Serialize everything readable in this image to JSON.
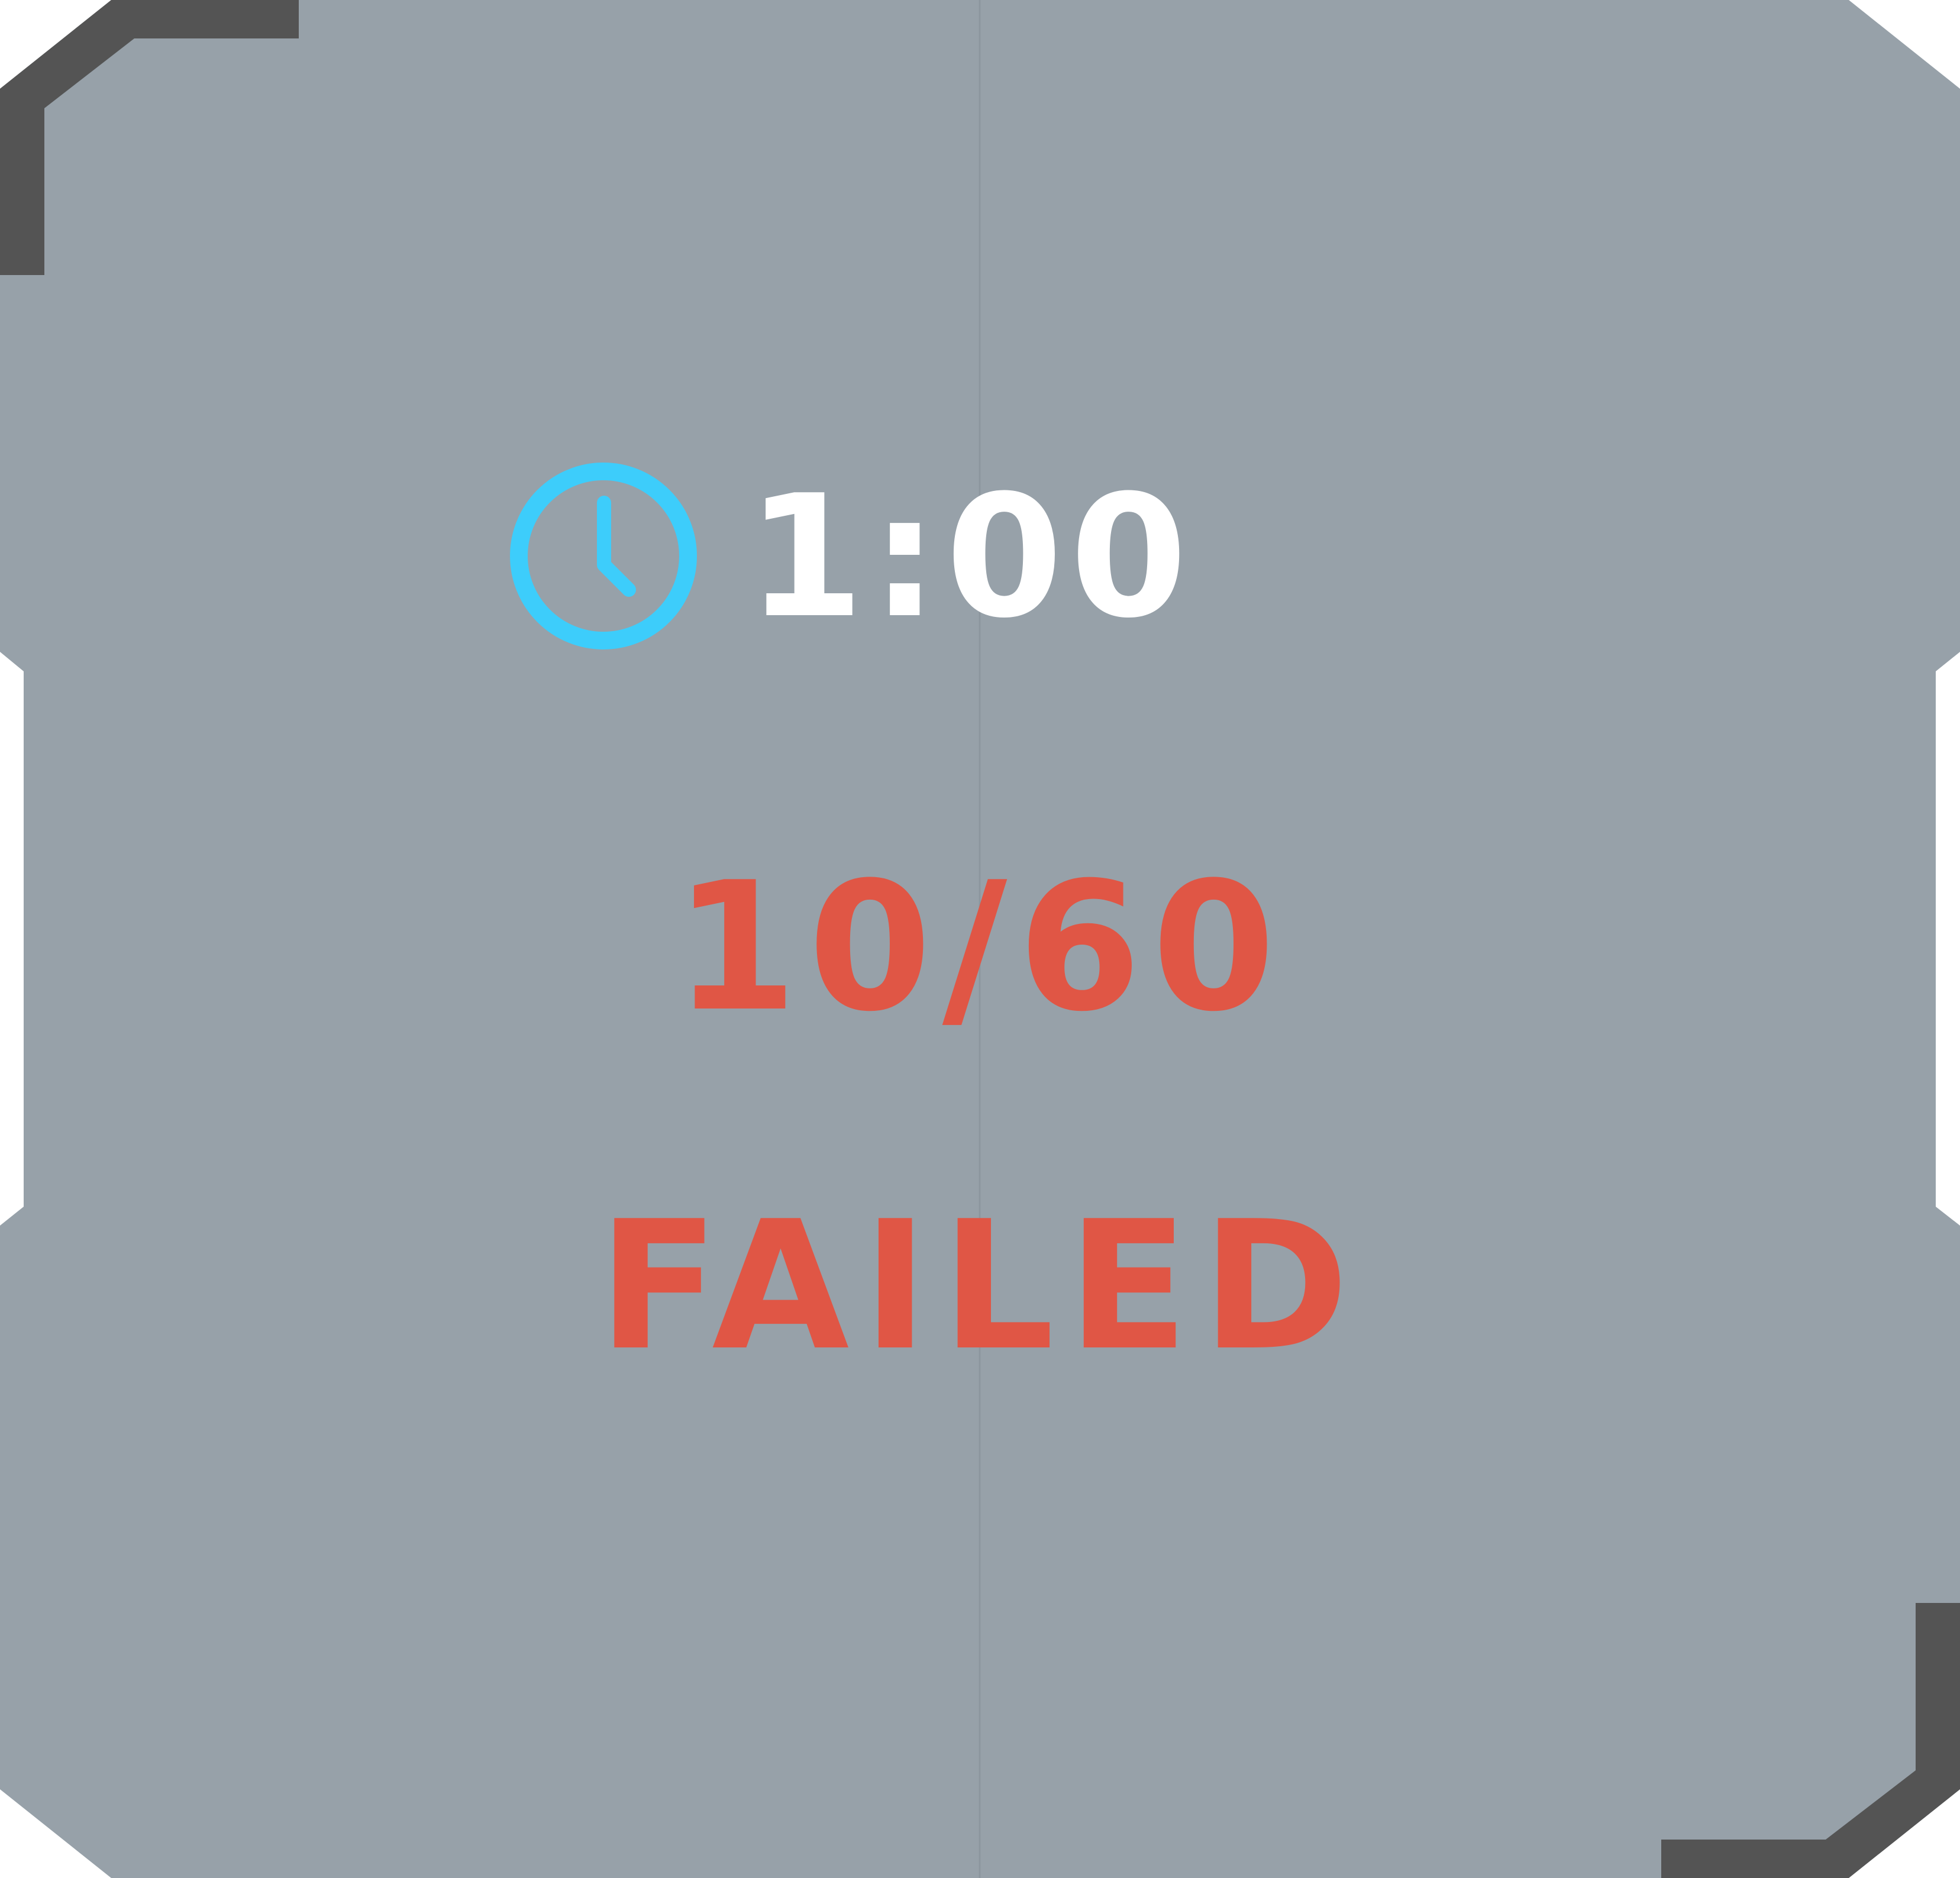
{
  "hud": {
    "timer": {
      "icon": "clock-icon",
      "value": "1:00"
    },
    "score": {
      "value": "10/60"
    },
    "status": {
      "label": "FAILED"
    }
  },
  "colors": {
    "panel_background": "#97a1a9",
    "panel_divider": "#8c969e",
    "corner_bracket": "#545454",
    "clock_icon": "#3dcdfb",
    "timer_text": "#ffffff",
    "result_failed": "#e05645"
  }
}
